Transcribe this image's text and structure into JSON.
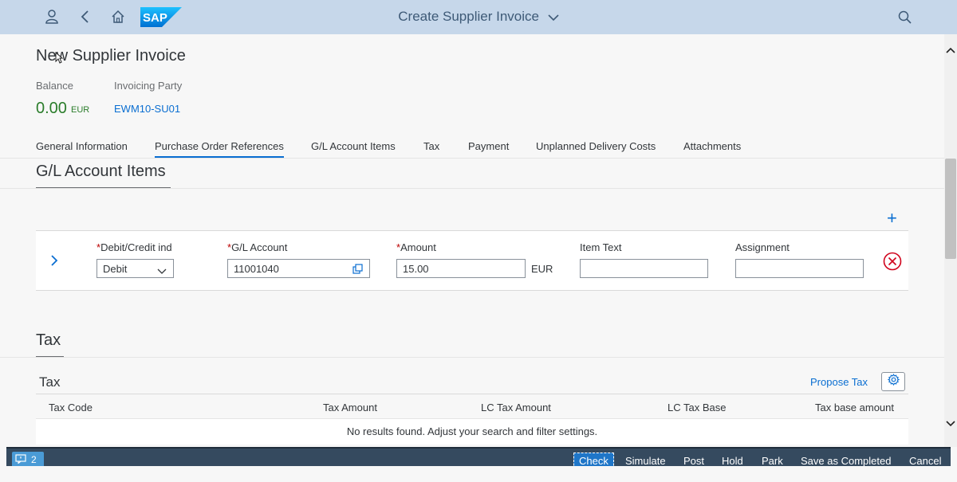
{
  "shell": {
    "title": "Create Supplier Invoice",
    "logo_text": "SAP"
  },
  "header": {
    "title": "New Supplier Invoice",
    "balance_label": "Balance",
    "balance_value": "0.00",
    "balance_currency": "EUR",
    "party_label": "Invoicing Party",
    "party_value": "EWM10-SU01"
  },
  "tabs": [
    {
      "label": "General Information"
    },
    {
      "label": "Purchase Order References"
    },
    {
      "label": "G/L Account Items"
    },
    {
      "label": "Tax"
    },
    {
      "label": "Payment"
    },
    {
      "label": "Unplanned Delivery Costs"
    },
    {
      "label": "Attachments"
    }
  ],
  "gl_section": {
    "title": "G/L Account Items",
    "fields": {
      "dc_label": "Debit/Credit ind",
      "dc_value": "Debit",
      "account_label": "G/L Account",
      "account_value": "11001040",
      "amount_label": "Amount",
      "amount_value": "15.00",
      "amount_currency": "EUR",
      "itemtext_label": "Item Text",
      "itemtext_value": "",
      "assignment_label": "Assignment",
      "assignment_value": ""
    },
    "required_marker": "*"
  },
  "tax_section": {
    "title": "Tax",
    "table_title": "Tax",
    "propose_label": "Propose Tax",
    "columns": [
      "Tax Code",
      "Tax Amount",
      "LC Tax Amount",
      "LC Tax Base",
      "Tax base amount"
    ],
    "no_results": "No results found. Adjust your search and filter settings."
  },
  "footer": {
    "message_count": "2",
    "buttons": [
      "Check",
      "Simulate",
      "Post",
      "Hold",
      "Park",
      "Save as Completed",
      "Cancel"
    ]
  },
  "colors": {
    "shell_bg": "#c6d7ea",
    "accent": "#0a6ed1",
    "positive": "#2b7d2b",
    "footer_bg": "#354a5f",
    "error": "#bb0000"
  }
}
